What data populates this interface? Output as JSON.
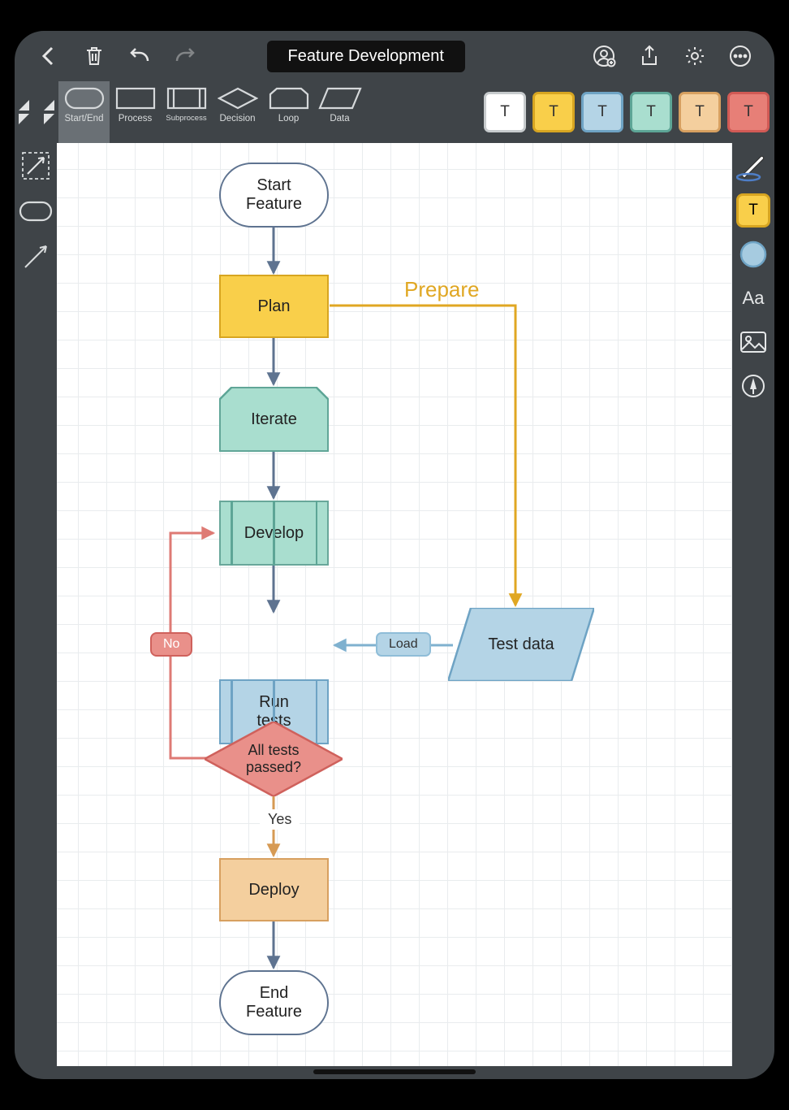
{
  "header": {
    "title": "Feature Development"
  },
  "shapebar": {
    "selected_index": 0,
    "items": [
      {
        "id": "start-end",
        "label": "Start/End"
      },
      {
        "id": "process",
        "label": "Process"
      },
      {
        "id": "subprocess",
        "label": "Subprocess"
      },
      {
        "id": "decision",
        "label": "Decision"
      },
      {
        "id": "loop",
        "label": "Loop"
      },
      {
        "id": "data",
        "label": "Data"
      }
    ]
  },
  "color_chips": [
    {
      "id": "white",
      "bg": "#ffffff",
      "border": "#c7cbcd",
      "letter": "T"
    },
    {
      "id": "yellow",
      "bg": "#f9cf4a",
      "border": "#d7a521",
      "letter": "T"
    },
    {
      "id": "blue",
      "bg": "#b4d4e6",
      "border": "#6ea3c4",
      "letter": "T"
    },
    {
      "id": "teal",
      "bg": "#a9decf",
      "border": "#5da596",
      "letter": "T"
    },
    {
      "id": "orange",
      "bg": "#f4cf9e",
      "border": "#d7a060",
      "letter": "T"
    },
    {
      "id": "red",
      "bg": "#e77f77",
      "border": "#d15a55",
      "letter": "T"
    }
  ],
  "right_rail": {
    "text_chip": {
      "bg": "#f9cf4a",
      "border": "#d7a521",
      "letter": "T"
    },
    "circle_fill": "#a6cbe0",
    "circle_stroke": "#6ea3c4",
    "aa_label": "Aa"
  },
  "flow": {
    "nodes": {
      "start": {
        "text_line1": "Start",
        "text_line2": "Feature"
      },
      "plan": {
        "text": "Plan"
      },
      "iterate": {
        "text": "Iterate"
      },
      "develop": {
        "text": "Develop"
      },
      "runtests": {
        "text_line1": "Run",
        "text_line2": "tests"
      },
      "decision": {
        "text_line1": "All tests",
        "text_line2": "passed?"
      },
      "deploy": {
        "text": "Deploy"
      },
      "end": {
        "text_line1": "End",
        "text_line2": "Feature"
      },
      "testdata": {
        "text": "Test data"
      }
    },
    "edge_labels": {
      "prepare": "Prepare",
      "load": "Load",
      "no": "No",
      "yes": "Yes"
    }
  },
  "chart_data": {
    "type": "flowchart",
    "title": "Feature Development",
    "nodes": [
      {
        "id": "start",
        "shape": "terminator",
        "label": "Start Feature"
      },
      {
        "id": "plan",
        "shape": "process",
        "label": "Plan",
        "color": "yellow"
      },
      {
        "id": "iterate",
        "shape": "loop",
        "label": "Iterate",
        "color": "teal"
      },
      {
        "id": "develop",
        "shape": "subprocess",
        "label": "Develop",
        "color": "teal"
      },
      {
        "id": "runtests",
        "shape": "subprocess",
        "label": "Run tests",
        "color": "blue"
      },
      {
        "id": "testdata",
        "shape": "data",
        "label": "Test data",
        "color": "blue"
      },
      {
        "id": "decision",
        "shape": "decision",
        "label": "All tests passed?",
        "color": "red"
      },
      {
        "id": "deploy",
        "shape": "process",
        "label": "Deploy",
        "color": "orange"
      },
      {
        "id": "end",
        "shape": "terminator",
        "label": "End Feature"
      }
    ],
    "edges": [
      {
        "from": "start",
        "to": "plan"
      },
      {
        "from": "plan",
        "to": "iterate"
      },
      {
        "from": "plan",
        "to": "testdata",
        "label": "Prepare"
      },
      {
        "from": "iterate",
        "to": "develop"
      },
      {
        "from": "develop",
        "to": "runtests"
      },
      {
        "from": "testdata",
        "to": "runtests",
        "label": "Load"
      },
      {
        "from": "runtests",
        "to": "decision"
      },
      {
        "from": "decision",
        "to": "develop",
        "label": "No"
      },
      {
        "from": "decision",
        "to": "deploy",
        "label": "Yes"
      },
      {
        "from": "deploy",
        "to": "end"
      }
    ]
  }
}
